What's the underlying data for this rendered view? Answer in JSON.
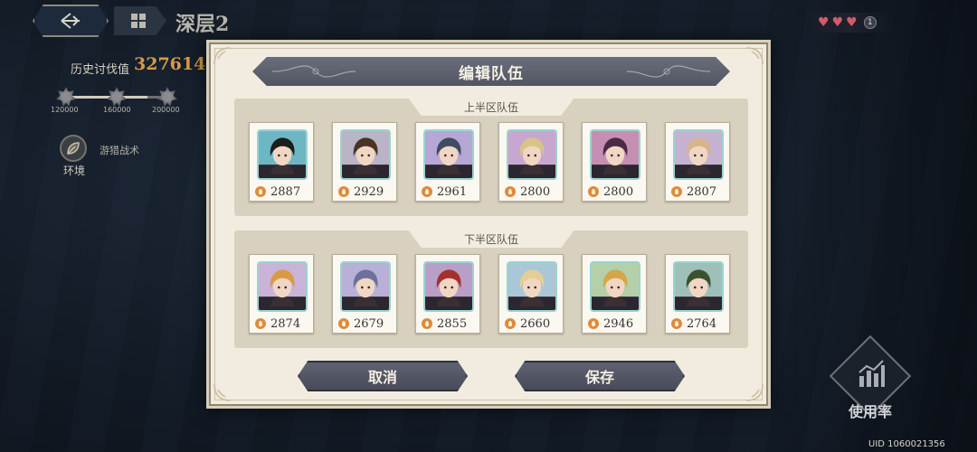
{
  "hud": {
    "level_title": "深层2",
    "history_label": "历史讨伐值",
    "history_value": "327614",
    "milestones": [
      "120000",
      "160000",
      "200000"
    ],
    "milestone_progress": 0.78,
    "env_label": "环境",
    "env_tactic": "游猎战术",
    "hearts": 3,
    "heart_count": "1",
    "usage_label": "使用率",
    "uid": "UID 1060021356"
  },
  "modal": {
    "title": "编辑队伍",
    "top_team_label": "上半区队伍",
    "bottom_team_label": "下半区队伍",
    "cancel_label": "取消",
    "save_label": "保存",
    "top_team": [
      {
        "power": "2887",
        "hair": "#1a1f1c",
        "bg": "#6fb6c4"
      },
      {
        "power": "2929",
        "hair": "#4a3325",
        "bg": "#b9b4c6"
      },
      {
        "power": "2961",
        "hair": "#3d4b63",
        "bg": "#b6a7d4"
      },
      {
        "power": "2800",
        "hair": "#d9c488",
        "bg": "#c7a7cf"
      },
      {
        "power": "2800",
        "hair": "#4a2a45",
        "bg": "#c48fb3"
      },
      {
        "power": "2807",
        "hair": "#d6b48e",
        "bg": "#c6b2d0"
      }
    ],
    "bottom_team": [
      {
        "power": "2874",
        "hair": "#d99a45",
        "bg": "#c9b4d8"
      },
      {
        "power": "2679",
        "hair": "#6d6f9c",
        "bg": "#b8b0d6"
      },
      {
        "power": "2855",
        "hair": "#a4302c",
        "bg": "#b99ec8"
      },
      {
        "power": "2660",
        "hair": "#e3cf95",
        "bg": "#a9c7d6"
      },
      {
        "power": "2946",
        "hair": "#d5a54a",
        "bg": "#b5cfa9"
      },
      {
        "power": "2764",
        "hair": "#3b5130",
        "bg": "#9fc0b9"
      }
    ]
  }
}
